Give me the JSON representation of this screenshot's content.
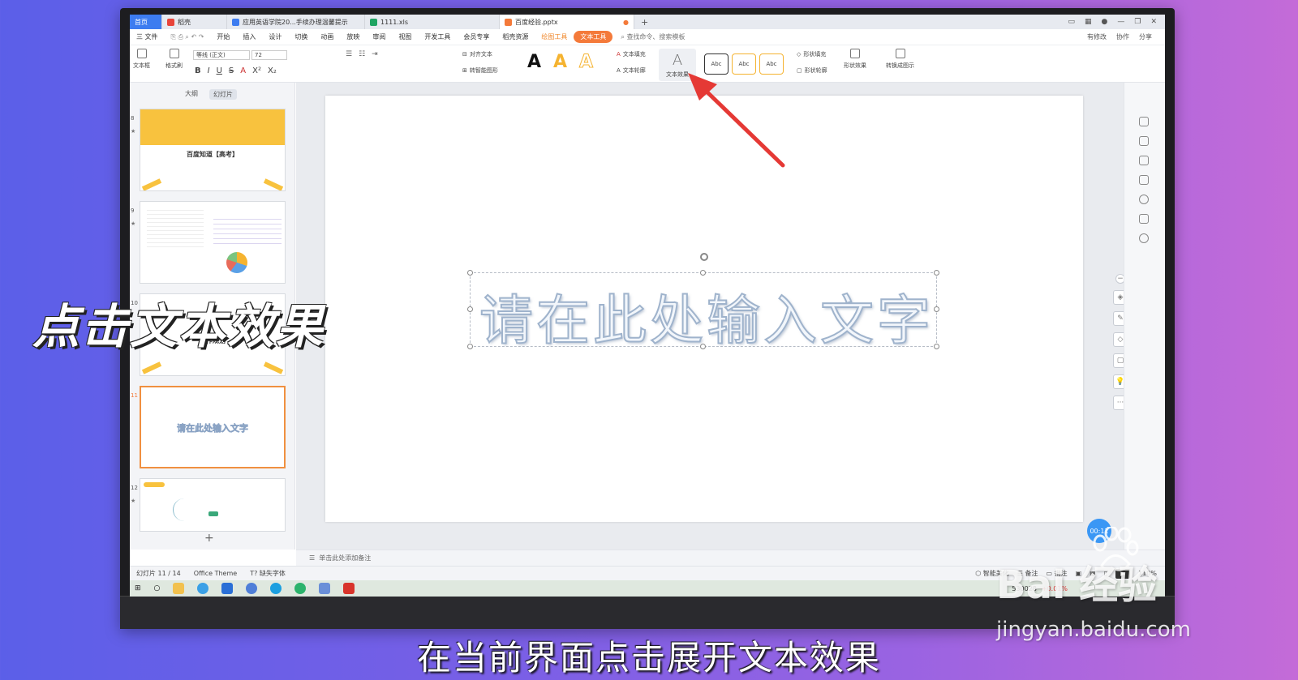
{
  "tabs": [
    {
      "label": "首页"
    },
    {
      "label": "稻壳"
    },
    {
      "label": "应用英语学院20...手续办理温馨提示"
    },
    {
      "label": "1111.xls"
    },
    {
      "label": "百度经验.pptx"
    }
  ],
  "menu": {
    "file": "三 文件",
    "items": [
      "开始",
      "插入",
      "设计",
      "切换",
      "动画",
      "放映",
      "审阅",
      "视图",
      "开发工具",
      "会员专享",
      "稻壳资源"
    ],
    "drawing_tools": "绘图工具",
    "text_tools": "文本工具",
    "search": "查找命令、搜索模板",
    "right": [
      "有修改",
      "协作",
      "分享"
    ]
  },
  "ribbon": {
    "textbox": "文本框",
    "format_painter": "格式刷",
    "font_name": "等线 (正文)",
    "font_size": "72",
    "align_text": "对齐文本",
    "smart_shape": "转智能图形",
    "text_fill": "文本填充",
    "text_outline": "文本轮廓",
    "text_effect": "文本效果",
    "style_sample": "Abc",
    "shape_fill": "形状填充",
    "shape_outline": "形状轮廓",
    "shape_effect": "形状效果",
    "convert_diagram": "转换成图示"
  },
  "pane": {
    "tab_outline": "大纲",
    "tab_slides": "幻灯片",
    "thumbs": [
      {
        "num": "8",
        "title": "百度知道【高考】"
      },
      {
        "num": "9"
      },
      {
        "num": "10",
        "title": "工作规划"
      },
      {
        "num": "11",
        "title": "请在此处输入文字"
      },
      {
        "num": "12"
      }
    ],
    "add": "+"
  },
  "slide": {
    "placeholder": "请在此处输入文字"
  },
  "timer": "00:11",
  "notes": "单击此处添加备注",
  "status": {
    "slide_count": "幻灯片 11 / 14",
    "theme": "Office Theme",
    "missing_font": "缺失字体",
    "smart_beautify": "智能美化",
    "notes_btn": "备注",
    "comment_btn": "批注",
    "zoom": "110%"
  },
  "taskbar": {
    "stock_code": "530028",
    "stock_change": "+0.01%"
  },
  "overlay": {
    "title": "点击文本效果",
    "subtitle": "在当前界面点击展开文本效果"
  },
  "watermark": {
    "brand": "Bai 经验",
    "url": "jingyan.baidu.com"
  },
  "colors": {
    "accent_orange": "#f47a3a",
    "arrow_red": "#e53935",
    "wps_blue": "#3d7cf0"
  }
}
